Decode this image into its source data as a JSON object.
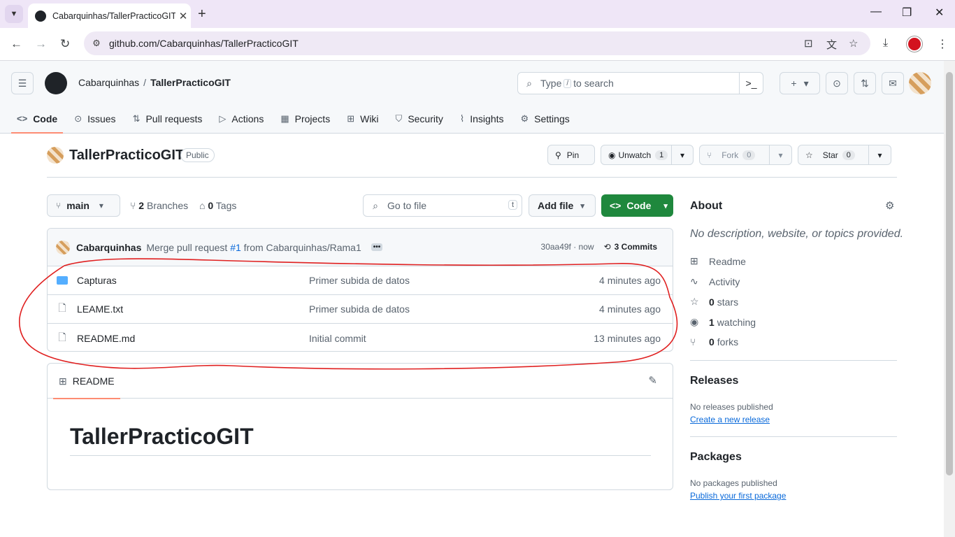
{
  "browser": {
    "tab_title": "Cabarquinhas/TallerPracticoGIT",
    "url": "github.com/Cabarquinhas/TallerPracticoGIT"
  },
  "header": {
    "owner": "Cabarquinhas",
    "separator": "/",
    "repo": "TallerPracticoGIT",
    "search_prefix": "Type",
    "search_key": "/",
    "search_suffix": "to search"
  },
  "nav": {
    "tabs": [
      {
        "label": "Code",
        "icon": "code-icon"
      },
      {
        "label": "Issues",
        "icon": "issue-icon"
      },
      {
        "label": "Pull requests",
        "icon": "pull-request-icon"
      },
      {
        "label": "Actions",
        "icon": "play-icon"
      },
      {
        "label": "Projects",
        "icon": "table-icon"
      },
      {
        "label": "Wiki",
        "icon": "book-icon"
      },
      {
        "label": "Security",
        "icon": "shield-icon"
      },
      {
        "label": "Insights",
        "icon": "graph-icon"
      },
      {
        "label": "Settings",
        "icon": "gear-icon"
      }
    ]
  },
  "repo": {
    "name": "TallerPracticoGIT",
    "visibility": "Public",
    "pin_label": "Pin",
    "unwatch_label": "Unwatch",
    "watch_count": "1",
    "fork_label": "Fork",
    "fork_count": "0",
    "star_label": "Star",
    "star_count": "0"
  },
  "toolbar": {
    "branch": "main",
    "branches_count": "2",
    "branches_label": "Branches",
    "tags_count": "0",
    "tags_label": "Tags",
    "goto_placeholder": "Go to file",
    "goto_key": "t",
    "add_file": "Add file",
    "code_label": "Code"
  },
  "commit": {
    "author": "Cabarquinhas",
    "msg_prefix": "Merge pull request",
    "pr": "#1",
    "msg_suffix": "from Cabarquinhas/Rama1",
    "ellipsis": "•••",
    "sha_time": "30aa49f · now",
    "commits": "3 Commits"
  },
  "files": [
    {
      "name": "Capturas",
      "type": "folder",
      "message": "Primer subida de datos",
      "age": "4 minutes ago"
    },
    {
      "name": "LEAME.txt",
      "type": "file",
      "message": "Primer subida de datos",
      "age": "4 minutes ago"
    },
    {
      "name": "README.md",
      "type": "file",
      "message": "Initial commit",
      "age": "13 minutes ago"
    }
  ],
  "readme": {
    "tab": "README",
    "heading": "TallerPracticoGIT"
  },
  "sidebar": {
    "about_title": "About",
    "about_desc": "No description, website, or topics provided.",
    "readme": "Readme",
    "activity": "Activity",
    "stars_count": "0",
    "stars_label": "stars",
    "watching_count": "1",
    "watching_label": "watching",
    "forks_count": "0",
    "forks_label": "forks",
    "releases_title": "Releases",
    "releases_none": "No releases published",
    "releases_link": "Create a new release",
    "packages_title": "Packages",
    "packages_none": "No packages published",
    "packages_link": "Publish your first package"
  },
  "colors": {
    "annotation": "#e02020",
    "primary_button": "#1f883d",
    "link": "#0969da",
    "tab_underline": "#fd8c73"
  }
}
